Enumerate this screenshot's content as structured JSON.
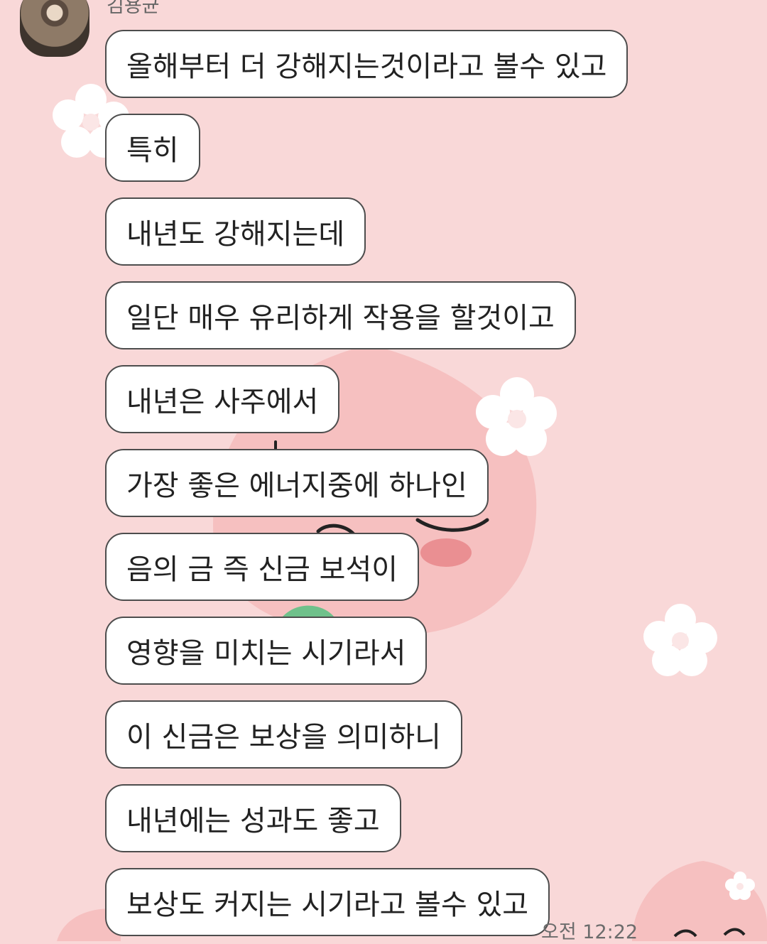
{
  "chat": {
    "sender_name": "김용균",
    "timestamp": "오전 12:22",
    "messages": [
      "올해부터 더 강해지는것이라고 볼수 있고",
      "특히",
      "내년도 강해지는데",
      "일단 매우 유리하게 작용을 할것이고",
      "내년은 사주에서",
      "가장 좋은 에너지중에 하나인",
      "음의 금 즉 신금 보석이",
      "영향을 미치는 시기라서",
      "이 신금은 보상을 의미하니",
      "내년에는 성과도 좋고",
      "보상도 커지는 시기라고 볼수 있고"
    ]
  },
  "theme": {
    "background": "#f9d8d8",
    "bubble": "#ffffff",
    "bubble_border": "#4d4d4d",
    "peach": "#f7bcbc",
    "leaf": "#6fc18b"
  },
  "decorations": [
    "flower-icon",
    "peach-character",
    "leaf-icon"
  ]
}
